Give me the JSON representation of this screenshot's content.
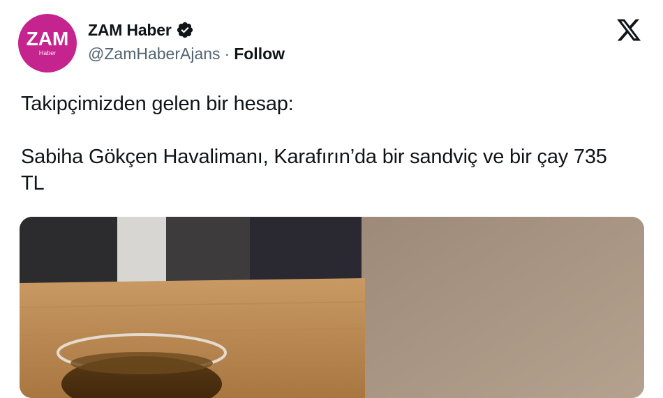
{
  "author": {
    "avatar_brand": "ZAM",
    "avatar_sub": "Haber",
    "display_name": "ZAM Haber",
    "handle": "@ZamHaberAjans",
    "separator": "·",
    "follow_label": "Follow",
    "verified_icon": "verified-badge-icon"
  },
  "platform_icon": "x-logo-icon",
  "tweet": {
    "line1": "Takipçimizden gelen bir hesap:",
    "line2": "Sabiha Gökçen Havalimanı, Karafırın’da bir sandviç ve bir çay 735 TL"
  },
  "colors": {
    "avatar_bg": "#c5248f",
    "text": "#0f1419",
    "muted": "#536471"
  },
  "media": {
    "description_icon": "photo-tea-glass-on-table"
  }
}
